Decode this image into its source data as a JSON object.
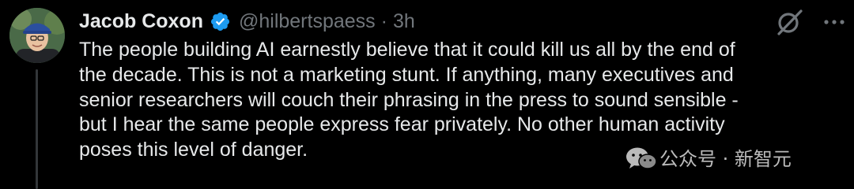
{
  "tweet": {
    "display_name": "Jacob Coxon",
    "handle": "@hilbertspaess",
    "separator": "·",
    "time": "3h",
    "body_lines": [
      "The people building AI earnestly believe that it could kill us all by the end of",
      "the decade. This is not a marketing stunt. If anything, many executives and",
      "senior researchers will couch their phrasing in the press to sound sensible -",
      "but I hear the same people express fear privately. No other human activity",
      "poses this level of danger."
    ]
  },
  "watermark": {
    "text": "公众号 · 新智元"
  },
  "colors": {
    "background": "#000000",
    "text_primary": "#e7e9ea",
    "text_secondary": "#71767b",
    "verified_blue": "#1d9bf0",
    "thread_line": "#333639"
  },
  "icons": {
    "verified": "verified-badge-icon",
    "grok": "grok-icon",
    "more": "more-options-icon",
    "wechat": "wechat-icon"
  }
}
